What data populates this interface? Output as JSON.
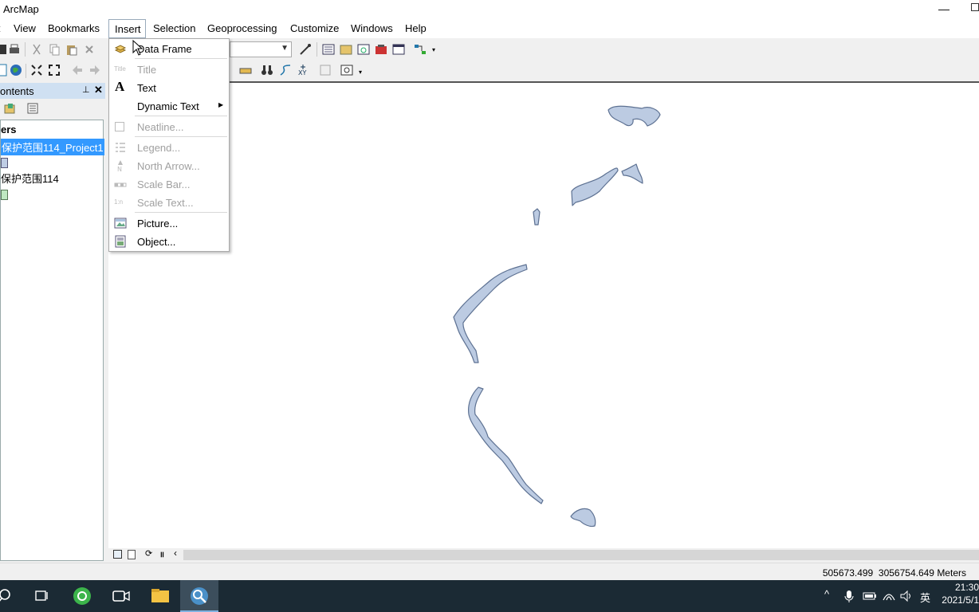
{
  "app": {
    "title": "ArcMap"
  },
  "menubar": {
    "items": [
      "View",
      "Bookmarks",
      "Insert",
      "Selection",
      "Geoprocessing",
      "Customize",
      "Windows",
      "Help"
    ]
  },
  "toc": {
    "title": "ontents",
    "layers_header": "ers",
    "layer1": "保护范围114_Project1",
    "layer2": "保护范围114"
  },
  "insert_menu": {
    "data_frame": "Data Frame",
    "title": "Title",
    "text": "Text",
    "dynamic_text": "Dynamic Text",
    "neatline": "Neatline...",
    "legend": "Legend...",
    "north_arrow": "North Arrow...",
    "scale_bar": "Scale Bar...",
    "scale_text": "Scale Text...",
    "picture": "Picture...",
    "object": "Object..."
  },
  "status": {
    "x": "505673.499",
    "y": "3056754.649 Meters"
  },
  "taskbar": {
    "time": "21:30",
    "date": "2021/5/1",
    "ime": "英"
  },
  "colors": {
    "selection": "#3399ff",
    "feature_fill": "#b9c9e0",
    "feature_stroke": "#5a6f8f",
    "taskbar": "#1b2a34"
  }
}
